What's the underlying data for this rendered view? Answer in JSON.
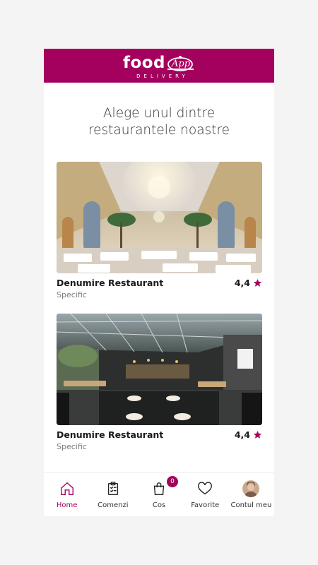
{
  "header": {
    "logo_food": "food",
    "logo_app": "App",
    "logo_sub": "DELIVERY",
    "brand_color": "#a4005e"
  },
  "page": {
    "heading_line1": "Alege unul dintre",
    "heading_line2": "restaurantele noastre"
  },
  "restaurants": [
    {
      "name": "Denumire Restaurant",
      "cuisine": "Specific",
      "rating": "4,4",
      "image": "ballroom-chandelier"
    },
    {
      "name": "Denumire Restaurant",
      "cuisine": "Specific",
      "rating": "4,4",
      "image": "glass-roof-terrace"
    }
  ],
  "nav": {
    "items": [
      {
        "label": "Home",
        "icon": "home-icon",
        "active": true
      },
      {
        "label": "Comenzi",
        "icon": "clipboard-icon",
        "active": false
      },
      {
        "label": "Cos",
        "icon": "bag-icon",
        "active": false,
        "badge": "0"
      },
      {
        "label": "Favorite",
        "icon": "heart-icon",
        "active": false
      },
      {
        "label": "Contul meu",
        "icon": "avatar",
        "active": false
      }
    ]
  }
}
